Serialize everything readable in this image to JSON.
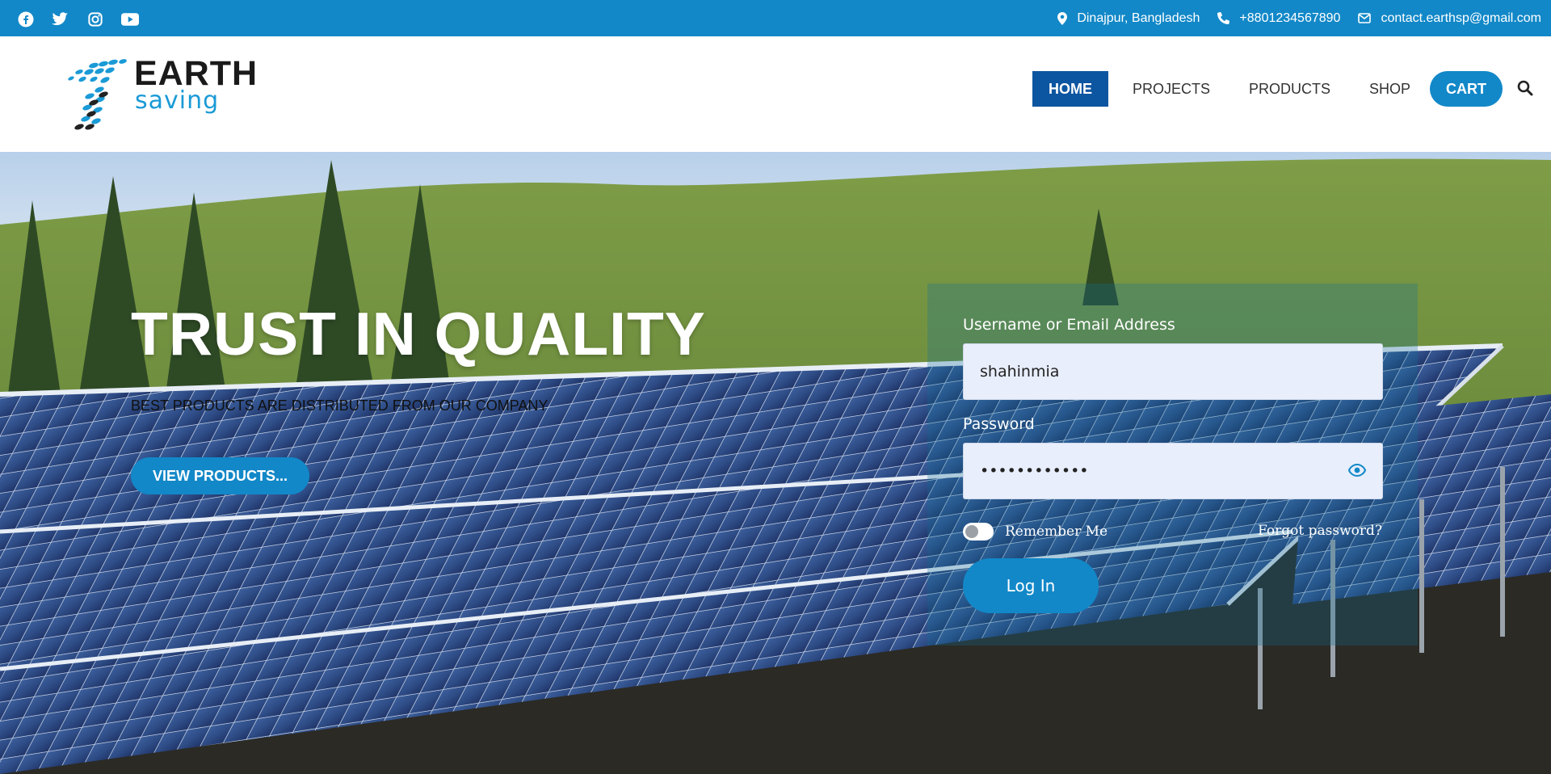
{
  "topbar": {
    "social": [
      "facebook-icon",
      "twitter-icon",
      "instagram-icon",
      "youtube-icon"
    ],
    "location": "Dinajpur, Bangladesh",
    "phone": "+8801234567890",
    "email": "contact.earthsp@gmail.com"
  },
  "logo": {
    "line1": "EARTH",
    "line2": "saving"
  },
  "nav": {
    "home": "HOME",
    "projects": "PROJECTS",
    "products": "PRODUCTS",
    "shop": "SHOP",
    "cart": "CART"
  },
  "hero": {
    "title": "TRUST IN QUALITY",
    "subtitle": "BEST PRODUCTS ARE DISTRIBUTED FROM OUR COMPANY",
    "button": "VIEW PRODUCTS..."
  },
  "login": {
    "username_label": "Username or Email Address",
    "username_value": "shahinmia",
    "password_label": "Password",
    "password_value": "••••••••••••",
    "remember": "Remember Me",
    "forgot": "Forgot password?",
    "submit": "Log In"
  },
  "colors": {
    "brand": "#1288c8",
    "nav_active": "#0c55a0"
  }
}
